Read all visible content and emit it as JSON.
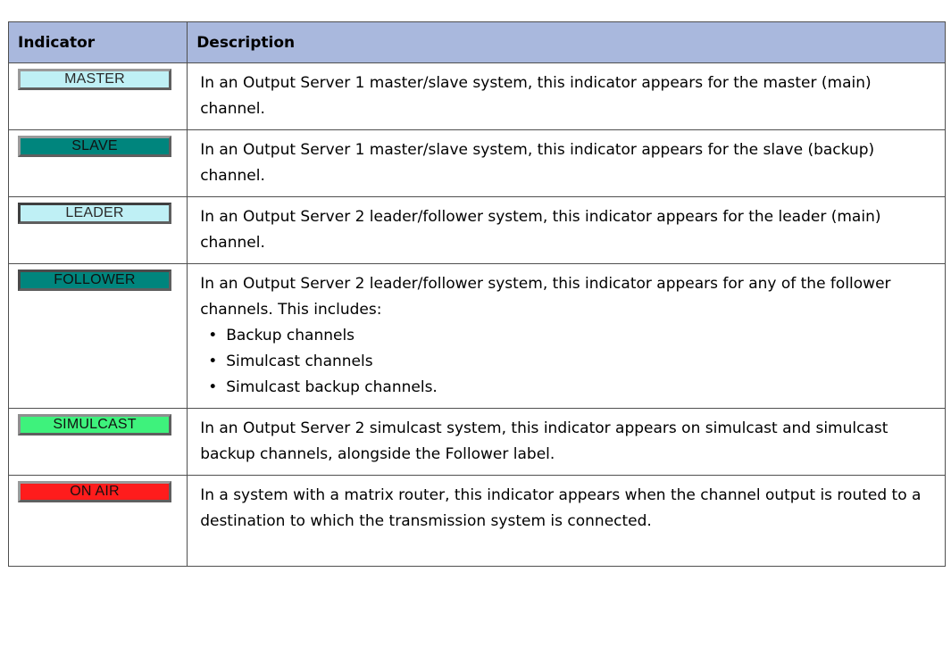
{
  "table": {
    "headers": {
      "indicator": "Indicator",
      "description": "Description"
    },
    "rows": [
      {
        "indicator_label": "MASTER",
        "indicator_style": "master",
        "description": "In an Output Server 1 master/slave system, this indicator appears for the master (main) channel."
      },
      {
        "indicator_label": "SLAVE",
        "indicator_style": "slave",
        "description": "In an Output Server 1 master/slave system, this indicator appears for the slave (backup) channel."
      },
      {
        "indicator_label": "LEADER",
        "indicator_style": "leader",
        "description": "In an Output Server 2 leader/follower system, this indicator appears for the leader (main) channel."
      },
      {
        "indicator_label": "FOLLOWER",
        "indicator_style": "follower",
        "description": "In an Output Server 2 leader/follower system, this indicator appears for any of the follower channels. This includes:",
        "bullets": [
          "Backup channels",
          "Simulcast channels",
          "Simulcast backup channels."
        ]
      },
      {
        "indicator_label": "SIMULCAST",
        "indicator_style": "simulcast",
        "description": "In an Output Server 2 simulcast system, this indicator appears on simulcast and simulcast backup channels, alongside the Follower label."
      },
      {
        "indicator_label": "ON AIR",
        "indicator_style": "onair",
        "description": "In a system with a matrix router, this indicator appears when the channel output is routed to a destination to which the transmission system is connected."
      }
    ]
  },
  "colors": {
    "header_background": "#a9b8dd",
    "border": "#4f4f4f",
    "master_leader_fill": "#bff0f5",
    "slave_follower_fill": "#00857d",
    "simulcast_fill": "#3ef27c",
    "on_air_fill": "#ff1c1c"
  }
}
